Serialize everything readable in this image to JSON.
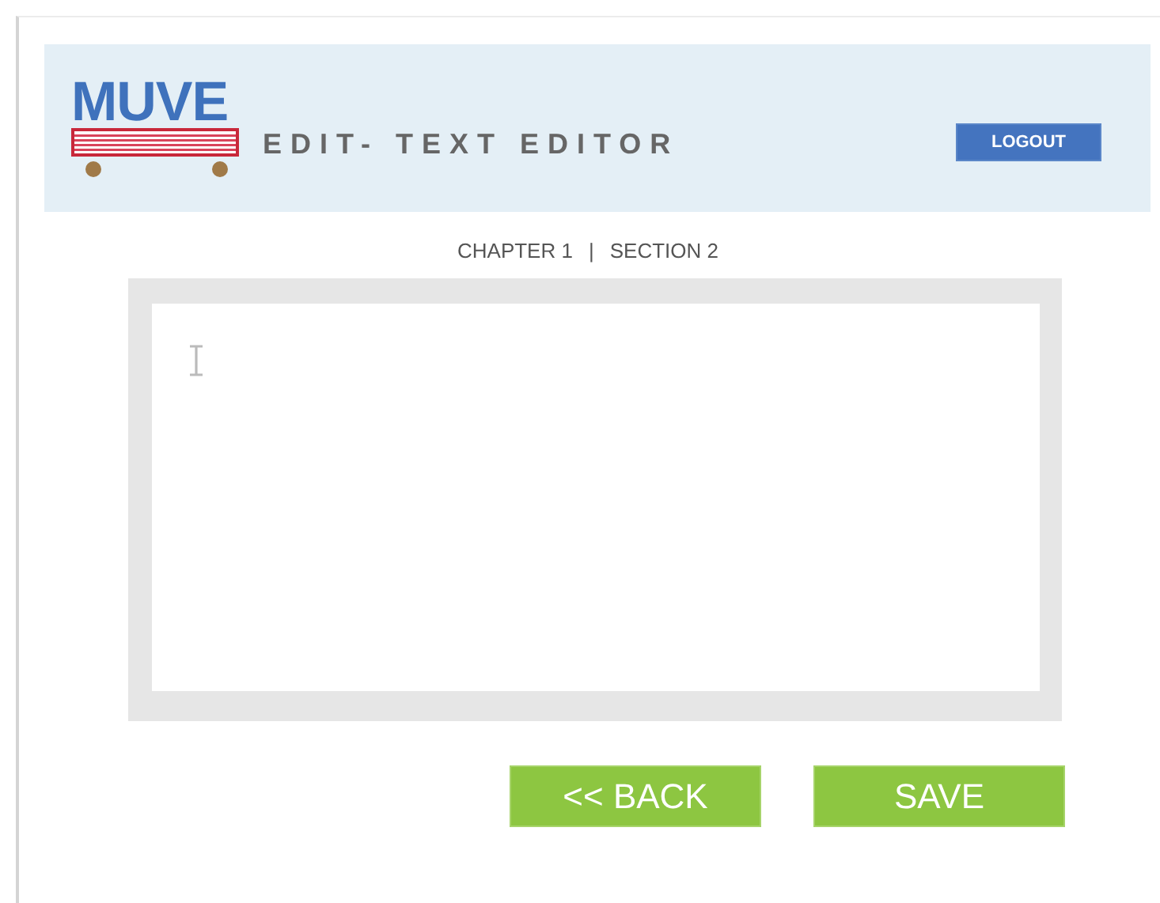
{
  "header": {
    "logo": "MUVE",
    "title": "EDIT- TEXT EDITOR",
    "logout_button": "LOGOUT"
  },
  "breadcrumb": [
    "CHAPTER 1",
    "|",
    "SECTION 2"
  ],
  "buttons": [
    "<< BACK",
    "SAVE"
  ]
}
